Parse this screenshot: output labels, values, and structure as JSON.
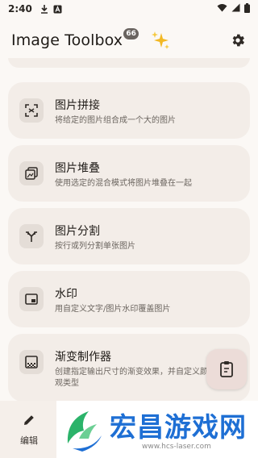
{
  "status_bar": {
    "time": "2:40",
    "icons": [
      "download-icon",
      "notification-a-icon",
      "wifi-icon",
      "signal-icon",
      "battery-icon"
    ]
  },
  "app_bar": {
    "title": "Image Toolbox",
    "version_badge": "66",
    "sparkle_icon": "sparkles-icon",
    "settings_icon": "gear-icon"
  },
  "tools": [
    {
      "title": "图片拼接",
      "subtitle": "将给定的图片组合成一个大的图片",
      "icon": "collage-icon"
    },
    {
      "title": "图片堆叠",
      "subtitle": "使用选定的混合模式将图片堆叠在一起",
      "icon": "stack-icon"
    },
    {
      "title": "图片分割",
      "subtitle": "按行或列分割单张图片",
      "icon": "split-icon"
    },
    {
      "title": "水印",
      "subtitle": "用自定义文字/图片水印覆盖图片",
      "icon": "watermark-icon"
    },
    {
      "title": "渐变制作器",
      "subtitle": "创建指定输出尺寸的渐变效果，并自定义颜色和外观类型",
      "icon": "gradient-icon"
    }
  ],
  "fab": {
    "icon": "clipboard-icon"
  },
  "bottom_nav": {
    "edit_label": "编辑",
    "edit_icon": "pencil-icon"
  },
  "watermark_overlay": {
    "text": "宏昌游戏网",
    "url": "www.hcs-laser.com"
  },
  "colors": {
    "background": "#fbf8f5",
    "card": "#f3ede8",
    "icon_box": "#e4ddd7",
    "fab": "#ecdcd8",
    "watermark_blue": "#1e6fd4",
    "watermark_green": "#2bb36a"
  }
}
